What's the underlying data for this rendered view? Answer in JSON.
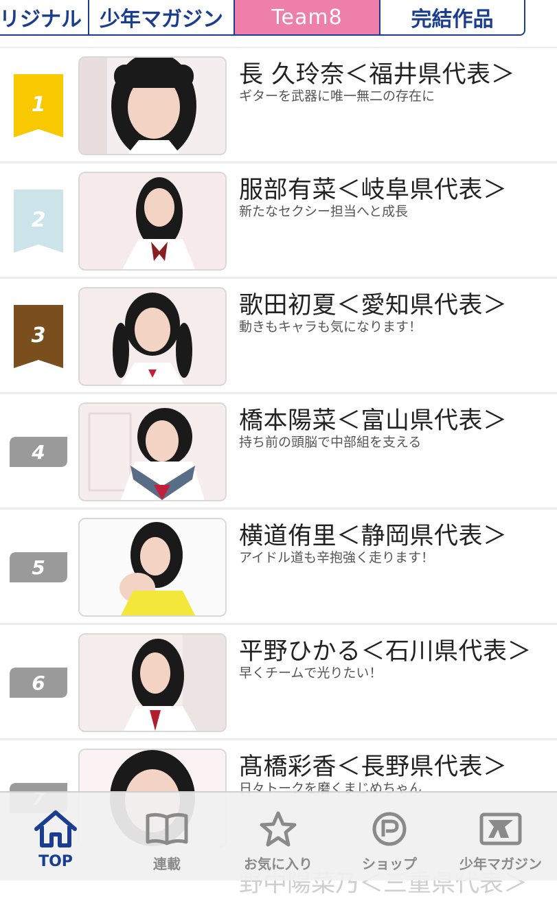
{
  "tabs": [
    {
      "label": "リジナル",
      "active": false
    },
    {
      "label": "少年マガジン",
      "active": false
    },
    {
      "label": "Team8",
      "active": true
    },
    {
      "label": "完結作品",
      "active": false
    }
  ],
  "ranking": [
    {
      "rank": "1",
      "name": "長 久玲奈＜福井県代表＞",
      "desc": "ギターを武器に唯一無二の存在に",
      "badge_color": "#f8c900",
      "badge_style": "ribbon"
    },
    {
      "rank": "2",
      "name": "服部有菜＜岐阜県代表＞",
      "desc": "新たなセクシー担当へと成長",
      "badge_color": "#cde3ea",
      "badge_style": "ribbon"
    },
    {
      "rank": "3",
      "name": "歌田初夏＜愛知県代表＞",
      "desc": "動きもキャラも気になります！",
      "badge_color": "#7b4e1e",
      "badge_style": "ribbon"
    },
    {
      "rank": "4",
      "name": "橋本陽菜＜富山県代表＞",
      "desc": "持ち前の頭脳で中部組を支える",
      "badge_color": "#9a9a9a",
      "badge_style": "tag"
    },
    {
      "rank": "5",
      "name": "横道侑里＜静岡県代表＞",
      "desc": "アイドル道も辛抱強く走ります！",
      "badge_color": "#9a9a9a",
      "badge_style": "tag"
    },
    {
      "rank": "6",
      "name": "平野ひかる＜石川県代表＞",
      "desc": "早くチームで光りたい！",
      "badge_color": "#9a9a9a",
      "badge_style": "tag"
    },
    {
      "rank": "7",
      "name": "髙橋彩香＜長野県代表＞",
      "desc": "日々トークを磨くまじめちゃん",
      "badge_color": "#9a9a9a",
      "badge_style": "tag"
    }
  ],
  "partial_next_name": "野中陽菜乃＜三重県代表＞",
  "bottom_nav": [
    {
      "label": "TOP",
      "icon": "home-icon",
      "active": true
    },
    {
      "label": "連載",
      "icon": "book-icon",
      "active": false
    },
    {
      "label": "お気に入り",
      "icon": "star-icon",
      "active": false
    },
    {
      "label": "ショップ",
      "icon": "shop-p-icon",
      "active": false
    },
    {
      "label": "少年マガジン",
      "icon": "magazine-icon",
      "active": false
    }
  ],
  "colors": {
    "accent_blue": "#1a3d8f",
    "tab_active": "#ee7fab",
    "nav_inactive": "#8a8a8a"
  }
}
